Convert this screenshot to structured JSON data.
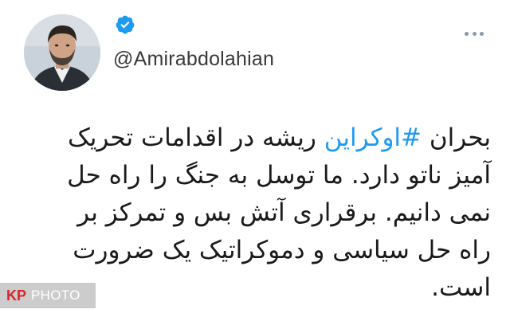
{
  "account": {
    "handle": "@Amirabdolahian",
    "verified": true,
    "avatar_icon": "profile-photo-icon",
    "verified_icon": "verified-badge-icon",
    "more_icon": "more-options-icon"
  },
  "tweet": {
    "lines": [
      {
        "pre": "بحران ",
        "hashtag": "#اوکراین",
        "post": " ریشه در اقدامات تحریک"
      },
      {
        "text": "آمیز ناتو دارد. ما توسل به جنگ را راه حل"
      },
      {
        "text": "نمی دانیم.  برقراری آتش بس و تمرکز بر"
      },
      {
        "text": "راه حل سیاسی و دموکراتیک یک ضرورت"
      },
      {
        "text": "است."
      }
    ]
  },
  "watermark": {
    "brand": "KP",
    "label": "PHOTO"
  },
  "colors": {
    "hashtag": "#1d9bf0",
    "verified": "#1d9bf0",
    "text": "#1a1a1a",
    "handle": "#3a3a3a",
    "watermark_brand": "#d6262b"
  }
}
